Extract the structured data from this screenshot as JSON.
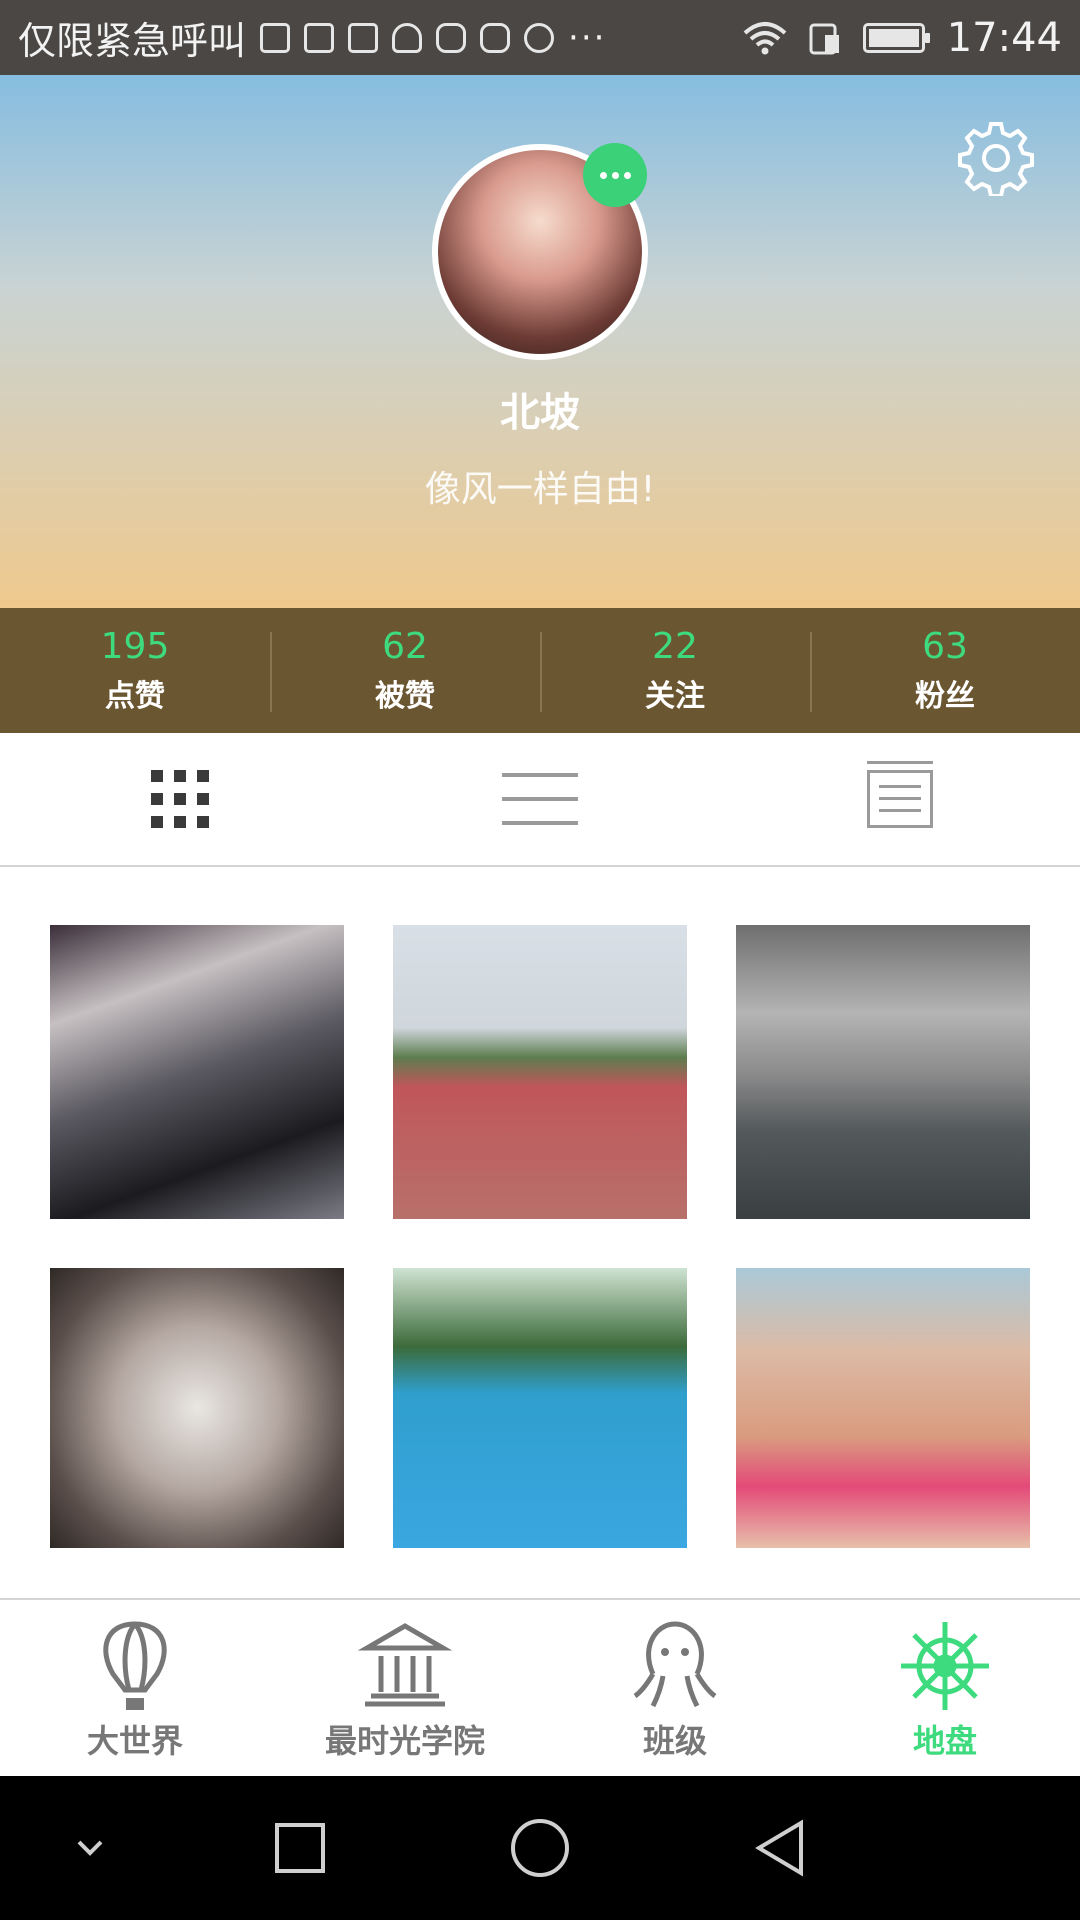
{
  "status_bar": {
    "carrier_text": "仅限紧急呼叫",
    "time": "17:44",
    "more_dots": "···"
  },
  "profile": {
    "username": "北坡",
    "bio": "像风一样自由!"
  },
  "stats": [
    {
      "value": "195",
      "label": "点赞"
    },
    {
      "value": "62",
      "label": "被赞"
    },
    {
      "value": "22",
      "label": "关注"
    },
    {
      "value": "63",
      "label": "粉丝"
    }
  ],
  "view_tabs": [
    "grid-view-icon",
    "list-view-icon",
    "calendar-view-icon"
  ],
  "bottom_nav": [
    {
      "label": "大世界",
      "icon": "hot-air-balloon-icon"
    },
    {
      "label": "最时光学院",
      "icon": "building-icon"
    },
    {
      "label": "班级",
      "icon": "octopus-icon"
    },
    {
      "label": "地盘",
      "icon": "ship-wheel-icon",
      "active": true
    }
  ],
  "colors": {
    "accent": "#3ddb7e",
    "stats_bar": "#6b5632",
    "inactive": "#777777"
  }
}
